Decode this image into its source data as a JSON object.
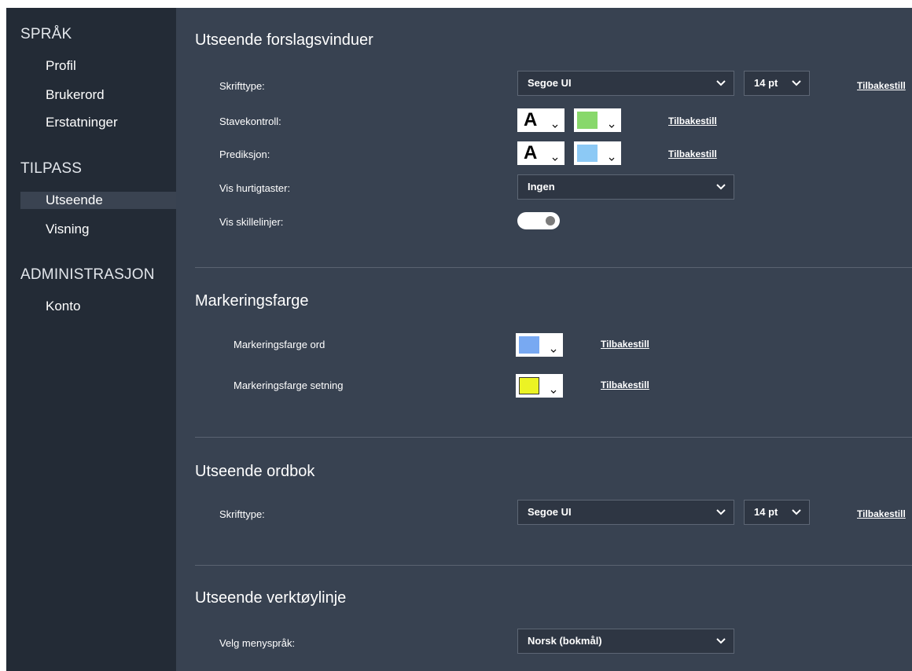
{
  "sidebar": {
    "sections": [
      {
        "title": "SPRÅK",
        "items": [
          "Profil",
          "Brukerord",
          "Erstatninger"
        ]
      },
      {
        "title": "TILPASS",
        "items": [
          "Utseende",
          "Visning"
        ]
      },
      {
        "title": "ADMINISTRASJON",
        "items": [
          "Konto"
        ]
      }
    ],
    "active_item": "Utseende"
  },
  "colors": {
    "sidebar_bg": "#232b36",
    "main_bg": "#384251",
    "stavekontroll_swatch": "#88d86b",
    "prediksjon_swatch": "#8cc9f5",
    "markering_ord_swatch": "#78a9f2",
    "markering_setning_swatch": "#ecf324"
  },
  "forslag": {
    "title": "Utseende forslagsvinduer",
    "skrifttype_label": "Skrifttype:",
    "font_value": "Segoe UI",
    "size_value": "14 pt",
    "reset": "Tilbakestill",
    "stavekontroll_label": "Stavekontroll:",
    "stavekontroll_letter": "A",
    "prediksjon_label": "Prediksjon:",
    "prediksjon_letter": "A",
    "hurtigtaster_label": "Vis hurtigtaster:",
    "hurtigtaster_value": "Ingen",
    "skillelinjer_label": "Vis skillelinjer:",
    "skillelinjer_on": true
  },
  "markering": {
    "title": "Markeringsfarge",
    "ord_label": "Markeringsfarge ord",
    "setning_label": "Markeringsfarge setning",
    "reset": "Tilbakestill"
  },
  "ordbok": {
    "title": "Utseende ordbok",
    "skrifttype_label": "Skrifttype:",
    "font_value": "Segoe UI",
    "size_value": "14 pt",
    "reset": "Tilbakestill"
  },
  "verktoylinje": {
    "title": "Utseende verktøylinje",
    "menysprak_label": "Velg menyspråk:",
    "menysprak_value": "Norsk (bokmål)"
  }
}
